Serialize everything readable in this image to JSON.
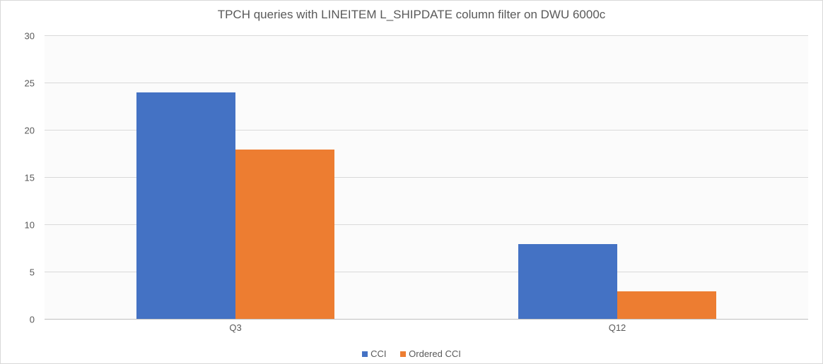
{
  "chart_data": {
    "type": "bar",
    "title": "TPCH queries with LINEITEM L_SHIPDATE column filter on DWU 6000c",
    "categories": [
      "Q3",
      "Q12"
    ],
    "series": [
      {
        "name": "CCI",
        "values": [
          24,
          8
        ]
      },
      {
        "name": "Ordered CCI",
        "values": [
          18,
          3
        ]
      }
    ],
    "ylim": [
      0,
      30
    ],
    "yticks": [
      0,
      5,
      10,
      15,
      20,
      25,
      30
    ],
    "xlabel": "",
    "ylabel": ""
  },
  "colors": {
    "CCI": "#4472c4",
    "Ordered CCI": "#ed7d31"
  }
}
